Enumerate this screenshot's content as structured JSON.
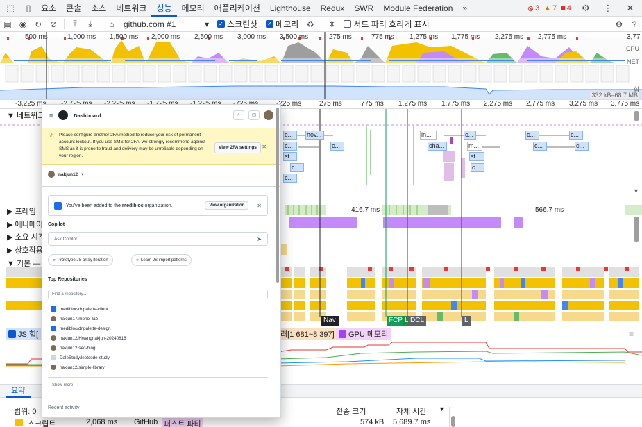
{
  "tabbar": {
    "tabs": [
      "요소",
      "콘솔",
      "소스",
      "네트워크",
      "성능",
      "메모리",
      "애플리케이션",
      "Lighthouse",
      "Redux",
      "SWR",
      "Module Federation"
    ],
    "active": "성능",
    "more": "»",
    "errors": "3",
    "warnings": "7",
    "issues": "4"
  },
  "toolbar": {
    "url": "github.com #1",
    "screenshot_label": "스크린샷",
    "memory_label": "메모리",
    "third_party_label": "서드 파티 흐리게 표시"
  },
  "overview": {
    "ticks": [
      "500 ms",
      "1,000 ms",
      "1,500 ms",
      "2,000 ms",
      "2,500 ms",
      "3,000 ms",
      "3,500 ms",
      "275 ms",
      "775 ms",
      "1,275 ms",
      "1,775 ms",
      "2,275 ms",
      "2,775 ms",
      "3,77"
    ],
    "cpu_label": "CPU",
    "net_label": "NET",
    "heap_label": "힙",
    "heap_range": "332 kB–68.7 MB"
  },
  "timeline": {
    "ticks": [
      "-3,225 ms",
      "-2,725 ms",
      "-2,225 ms",
      "-1,725 ms",
      "-1,225 ms",
      "-725 ms",
      "-225 ms",
      "275 ms",
      "775 ms",
      "1,275 ms",
      "1,775 ms",
      "2,275 ms",
      "2,775 ms",
      "3,275 ms",
      "3,775 ms"
    ]
  },
  "tracks": {
    "network": "네트워크",
    "frames": "프레임",
    "animations": "애니메이션",
    "timings": "소요 시간",
    "interactions": "상호작용",
    "main": "기본 —",
    "frame_time_1": "416.7 ms",
    "frame_time_2": "566.7 ms",
    "network_boxes": [
      "c...",
      "hov...",
      "c...",
      "in...",
      "c...",
      "c...",
      "c...",
      "c...",
      "c...",
      "cha...",
      "m...",
      "c...",
      "st...",
      "st...",
      "c...",
      "c...",
      "c..."
    ]
  },
  "markers": {
    "nav": "Nav",
    "fcp": "FCP",
    "lcp": "LCP",
    "dcl": "DCL",
    "l": "L"
  },
  "memory": {
    "js_heap": "JS 힙[",
    "nodes_range": "러[1 681~8 397]",
    "gpu": "GPU 메모리"
  },
  "bottom": {
    "tab_summary": "요약",
    "range_label": "범위: 0",
    "col_transfer": "전송 크기",
    "col_self_time": "자체 시간",
    "row_category": "스크립트",
    "row_time": "2,068 ms",
    "row_name": "GitHub",
    "row_badge": "퍼스트 파티",
    "row_transfer": "574 kB",
    "row_self": "5,689.7 ms"
  },
  "github": {
    "title": "Dashboard",
    "banner_text": "Please configure another 2FA method to reduce your risk of permanent account lockout. If you use SMS for 2FA, we strongly recommend against SMS as it is prone to fraud and delivery may be unreliable depending on your region.",
    "banner_button": "View 2FA settings",
    "username": "nakjun12",
    "org_message_pre": "You've been added to the ",
    "org_name": "medibloc",
    "org_message_post": " organization.",
    "view_org": "View organization",
    "copilot": "Copilot",
    "ask_placeholder": "Ask Copilot",
    "chip1": "Prototype JS array iteration",
    "chip2": "Learn JS import patterns",
    "top_repos": "Top Repositories",
    "find_placeholder": "Find a repository...",
    "repos": [
      "medibloc/dnpalette-client",
      "nakjun17/monoi-lab",
      "medibloc/dnpalette-design",
      "nakjun12/Hwangnakjun-20240816",
      "nakjun12/seo-blog",
      "DaleStudy/leetcode-study",
      "nakjun12/simple-library"
    ],
    "show_more": "Show more",
    "recent_activity": "Recent activity"
  }
}
